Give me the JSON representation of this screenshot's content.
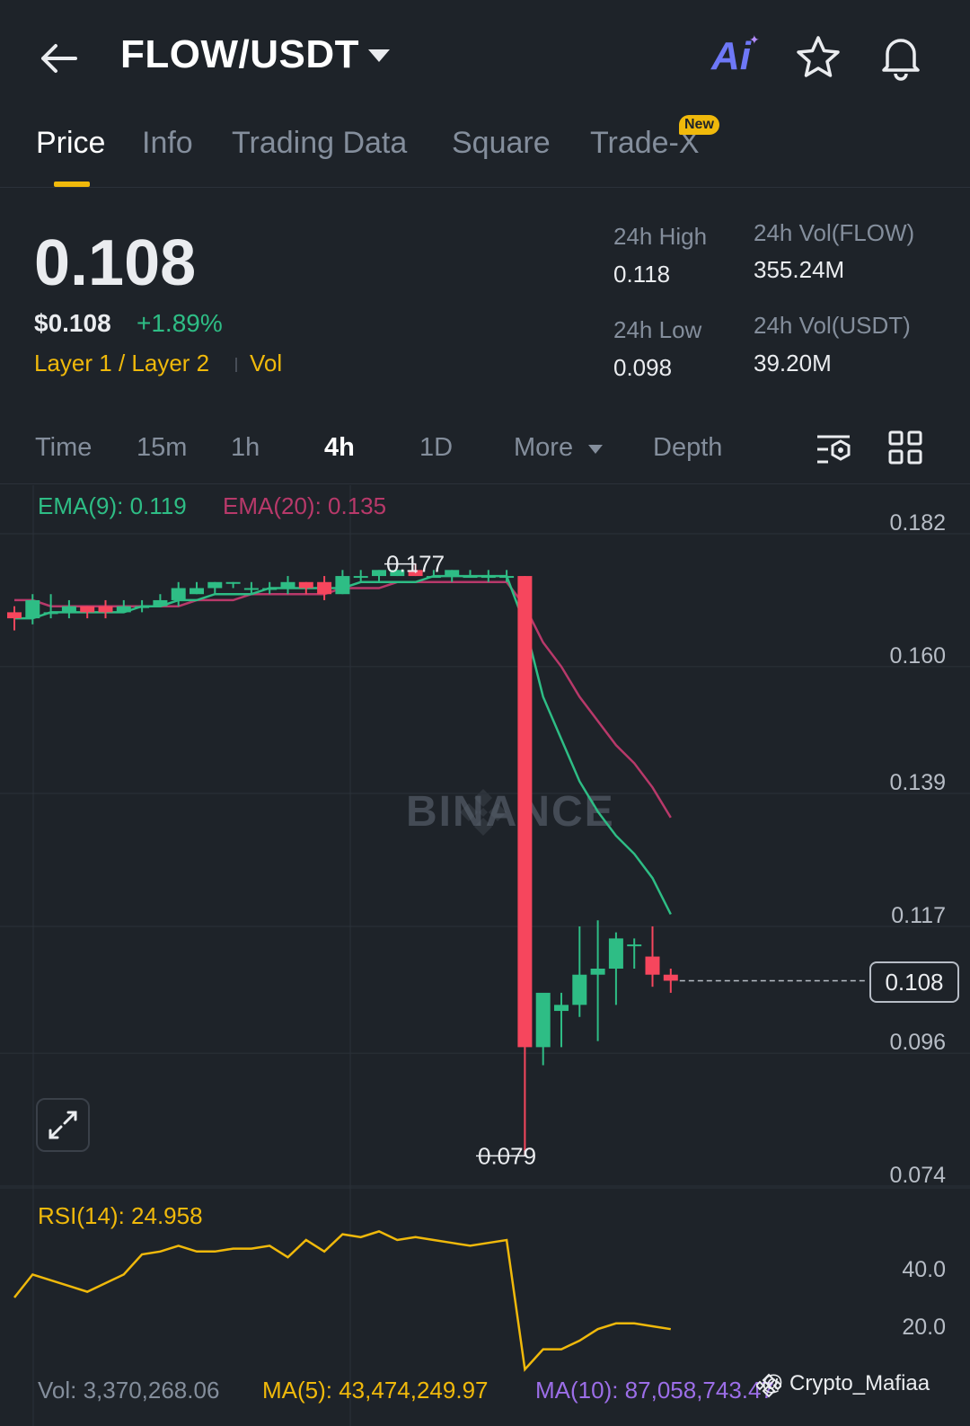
{
  "header": {
    "pair": "FLOW/USDT",
    "ai_label": "Ai"
  },
  "tabs": [
    {
      "label": "Price",
      "active": true
    },
    {
      "label": "Info"
    },
    {
      "label": "Trading Data"
    },
    {
      "label": "Square"
    },
    {
      "label": "Trade-X",
      "badge": "New"
    }
  ],
  "price": {
    "last": "0.108",
    "usd": "$0.108",
    "change": "+1.89%",
    "tags": [
      "Layer 1 / Layer 2",
      "Vol"
    ]
  },
  "stats": {
    "high_label": "24h High",
    "high_value": "0.118",
    "low_label": "24h Low",
    "low_value": "0.098",
    "vol_flow_label": "24h Vol(FLOW)",
    "vol_flow_value": "355.24M",
    "vol_usdt_label": "24h Vol(USDT)",
    "vol_usdt_value": "39.20M"
  },
  "timeframes": [
    "Time",
    "15m",
    "1h",
    "4h",
    "1D",
    "More",
    "Depth"
  ],
  "active_timeframe": "4h",
  "indicators": {
    "ema9": "EMA(9): 0.119",
    "ema20": "EMA(20): 0.135",
    "rsi": "RSI(14): 24.958",
    "vol": "Vol: 3,370,268.06",
    "ma5": "MA(5): 43,474,249.97",
    "ma10": "MA(10): 87,058,743.47"
  },
  "watermark": "BINANCE",
  "credit": "@ Crypto_Mafiaa",
  "colors": {
    "background": "#1e2329",
    "up": "#2ebd85",
    "down": "#f6465d",
    "accent": "#f0b90b",
    "ema20": "#b8396a"
  },
  "chart_data": {
    "type": "candlestick",
    "price_axis_ticks": [
      "0.182",
      "0.160",
      "0.139",
      "0.117",
      "0.096",
      "0.074"
    ],
    "price_axis_values": [
      0.182,
      0.16,
      0.139,
      0.117,
      0.096,
      0.074
    ],
    "high_marker": "0.177",
    "low_marker": "0.079",
    "last_price": "0.108",
    "rsi_axis_ticks": [
      "40.0",
      "20.0"
    ],
    "rsi_axis_values": [
      40,
      20
    ],
    "candles": [
      {
        "o": 0.169,
        "h": 0.17,
        "l": 0.166,
        "c": 0.168
      },
      {
        "o": 0.168,
        "h": 0.172,
        "l": 0.167,
        "c": 0.171
      },
      {
        "o": 0.169,
        "h": 0.172,
        "l": 0.168,
        "c": 0.169
      },
      {
        "o": 0.169,
        "h": 0.171,
        "l": 0.168,
        "c": 0.17
      },
      {
        "o": 0.17,
        "h": 0.17,
        "l": 0.168,
        "c": 0.169
      },
      {
        "o": 0.17,
        "h": 0.171,
        "l": 0.168,
        "c": 0.169
      },
      {
        "o": 0.169,
        "h": 0.171,
        "l": 0.169,
        "c": 0.17
      },
      {
        "o": 0.17,
        "h": 0.171,
        "l": 0.169,
        "c": 0.17
      },
      {
        "o": 0.17,
        "h": 0.172,
        "l": 0.17,
        "c": 0.171
      },
      {
        "o": 0.171,
        "h": 0.174,
        "l": 0.17,
        "c": 0.173
      },
      {
        "o": 0.172,
        "h": 0.174,
        "l": 0.172,
        "c": 0.173
      },
      {
        "o": 0.173,
        "h": 0.174,
        "l": 0.172,
        "c": 0.174
      },
      {
        "o": 0.174,
        "h": 0.174,
        "l": 0.173,
        "c": 0.174
      },
      {
        "o": 0.173,
        "h": 0.174,
        "l": 0.172,
        "c": 0.173
      },
      {
        "o": 0.173,
        "h": 0.174,
        "l": 0.172,
        "c": 0.173
      },
      {
        "o": 0.173,
        "h": 0.175,
        "l": 0.172,
        "c": 0.174
      },
      {
        "o": 0.174,
        "h": 0.174,
        "l": 0.172,
        "c": 0.173
      },
      {
        "o": 0.174,
        "h": 0.175,
        "l": 0.171,
        "c": 0.172
      },
      {
        "o": 0.172,
        "h": 0.176,
        "l": 0.172,
        "c": 0.175
      },
      {
        "o": 0.175,
        "h": 0.176,
        "l": 0.174,
        "c": 0.175
      },
      {
        "o": 0.175,
        "h": 0.176,
        "l": 0.174,
        "c": 0.176
      },
      {
        "o": 0.175,
        "h": 0.176,
        "l": 0.175,
        "c": 0.176
      },
      {
        "o": 0.176,
        "h": 0.177,
        "l": 0.175,
        "c": 0.175
      },
      {
        "o": 0.175,
        "h": 0.176,
        "l": 0.175,
        "c": 0.175
      },
      {
        "o": 0.175,
        "h": 0.176,
        "l": 0.174,
        "c": 0.176
      },
      {
        "o": 0.175,
        "h": 0.176,
        "l": 0.175,
        "c": 0.175
      },
      {
        "o": 0.175,
        "h": 0.176,
        "l": 0.174,
        "c": 0.175
      },
      {
        "o": 0.175,
        "h": 0.176,
        "l": 0.174,
        "c": 0.175
      },
      {
        "o": 0.175,
        "h": 0.175,
        "l": 0.079,
        "c": 0.097
      },
      {
        "o": 0.097,
        "h": 0.105,
        "l": 0.094,
        "c": 0.106
      },
      {
        "o": 0.103,
        "h": 0.106,
        "l": 0.097,
        "c": 0.104
      },
      {
        "o": 0.104,
        "h": 0.117,
        "l": 0.102,
        "c": 0.109
      },
      {
        "o": 0.109,
        "h": 0.118,
        "l": 0.098,
        "c": 0.11
      },
      {
        "o": 0.11,
        "h": 0.116,
        "l": 0.104,
        "c": 0.115
      },
      {
        "o": 0.114,
        "h": 0.115,
        "l": 0.11,
        "c": 0.114
      },
      {
        "o": 0.112,
        "h": 0.117,
        "l": 0.107,
        "c": 0.109
      },
      {
        "o": 0.109,
        "h": 0.11,
        "l": 0.106,
        "c": 0.108
      }
    ],
    "ema9": [
      0.168,
      0.168,
      0.169,
      0.169,
      0.169,
      0.169,
      0.169,
      0.17,
      0.17,
      0.171,
      0.171,
      0.172,
      0.172,
      0.172,
      0.173,
      0.173,
      0.173,
      0.173,
      0.173,
      0.174,
      0.174,
      0.174,
      0.174,
      0.175,
      0.175,
      0.175,
      0.175,
      0.175,
      0.167,
      0.155,
      0.148,
      0.141,
      0.136,
      0.132,
      0.129,
      0.125,
      0.119
    ],
    "ema20": [
      0.171,
      0.171,
      0.17,
      0.17,
      0.17,
      0.17,
      0.17,
      0.17,
      0.17,
      0.17,
      0.171,
      0.171,
      0.171,
      0.172,
      0.172,
      0.172,
      0.172,
      0.172,
      0.173,
      0.173,
      0.173,
      0.174,
      0.174,
      0.174,
      0.174,
      0.174,
      0.174,
      0.174,
      0.17,
      0.164,
      0.16,
      0.155,
      0.151,
      0.147,
      0.144,
      0.14,
      0.135
    ],
    "rsi": [
      30,
      38,
      36,
      34,
      32,
      35,
      38,
      45,
      46,
      48,
      46,
      46,
      47,
      47,
      48,
      44,
      50,
      46,
      52,
      51,
      53,
      50,
      51,
      50,
      49,
      48,
      49,
      50,
      5,
      12,
      12,
      15,
      19,
      21,
      21,
      20,
      19
    ]
  }
}
